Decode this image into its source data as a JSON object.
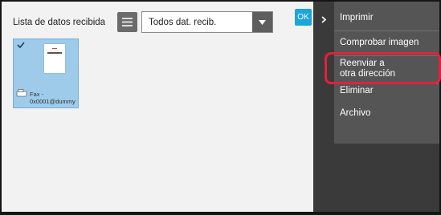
{
  "list": {
    "title": "Lista de datos recibida",
    "filter_value": "Todos dat. recib.",
    "ok_label": "OK"
  },
  "item": {
    "label_line1": "Fax -",
    "label_line2": "0x0001@dummy",
    "selected": true
  },
  "menu": {
    "items": [
      {
        "label": "Imprimir"
      },
      {
        "label": "Comprobar imagen"
      },
      {
        "label_line1": "Reenviar a",
        "label_line2": "otra dirección"
      },
      {
        "label": "Eliminar"
      },
      {
        "label": "Archivo"
      }
    ]
  },
  "colors": {
    "ok": "#1ea5d9",
    "highlight": "#e3213b",
    "thumb": "#9dcbe9"
  }
}
